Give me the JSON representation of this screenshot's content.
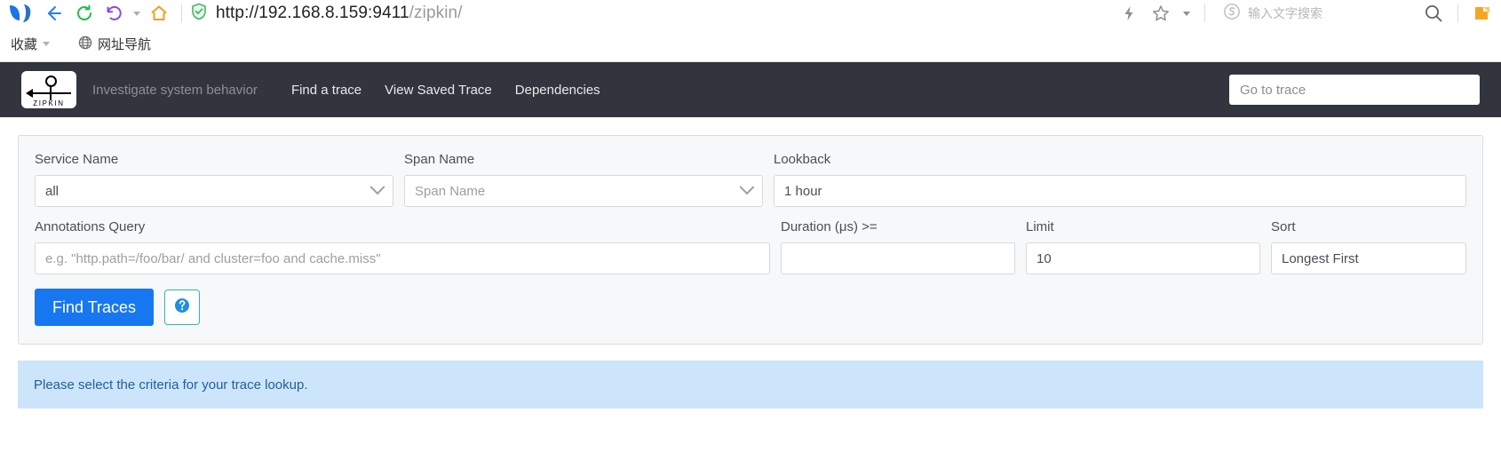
{
  "browser": {
    "icons": {
      "back": "back-arrow-icon",
      "reload": "reload-icon",
      "undo": "undo-arrow-icon",
      "home": "home-icon",
      "shield": "security-shield-icon",
      "lightning": "lightning-icon",
      "star": "star-icon",
      "caret": "chevron-down-icon",
      "sogou": "sogou-s-icon",
      "search": "search-icon"
    },
    "url": {
      "scheme_host": "http://192.168.8.159:9411",
      "path": "/zipkin/"
    },
    "search_placeholder": "输入文字搜索",
    "bookmarks": {
      "favorites_label": "收藏",
      "nav_label": "网址导航"
    }
  },
  "zipkin_nav": {
    "logo_wordmark": "ZIPKIN",
    "tagline": "Investigate system behavior",
    "links": [
      {
        "label": "Find a trace"
      },
      {
        "label": "View Saved Trace"
      },
      {
        "label": "Dependencies"
      }
    ],
    "goto_trace_placeholder": "Go to trace"
  },
  "search_form": {
    "service_name": {
      "label": "Service Name",
      "value": "all"
    },
    "span_name": {
      "label": "Span Name",
      "placeholder": "Span Name"
    },
    "lookback": {
      "label": "Lookback",
      "value": "1 hour"
    },
    "annotations_query": {
      "label": "Annotations Query",
      "placeholder": "e.g. \"http.path=/foo/bar/ and cluster=foo and cache.miss\""
    },
    "duration": {
      "label": "Duration (μs) >=",
      "value": ""
    },
    "limit": {
      "label": "Limit",
      "value": "10"
    },
    "sort": {
      "label": "Sort",
      "value": "Longest First"
    },
    "find_traces_label": "Find Traces",
    "help_icon": "question-mark-icon"
  },
  "info_banner": {
    "message": "Please select the criteria for your trace lookup."
  },
  "colors": {
    "navbar_bg": "#32353d",
    "primary_button": "#1777f1",
    "panel_bg": "#f7f8fa",
    "banner_bg": "#cde5fb",
    "banner_text": "#1f5fa0",
    "help_border": "#37b0b0"
  }
}
